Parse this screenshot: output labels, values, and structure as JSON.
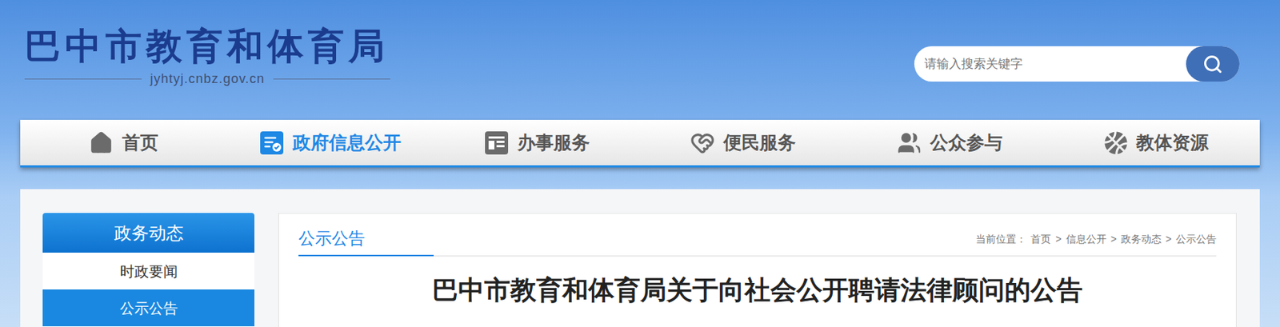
{
  "header": {
    "logo_title": "巴中市教育和体育局",
    "domain": "jyhtyj.cnbz.gov.cn"
  },
  "search": {
    "placeholder": "请输入搜索关键字"
  },
  "nav": [
    {
      "label": "首页",
      "selected": false,
      "kind": "home"
    },
    {
      "label": "政府信息公开",
      "selected": true,
      "kind": "info"
    },
    {
      "label": "办事服务",
      "selected": false,
      "kind": "service"
    },
    {
      "label": "便民服务",
      "selected": false,
      "kind": "convenience"
    },
    {
      "label": "公众参与",
      "selected": false,
      "kind": "public"
    },
    {
      "label": "教体资源",
      "selected": false,
      "kind": "resource"
    }
  ],
  "sidebar": {
    "title": "政务动态",
    "items": [
      {
        "label": "时政要闻",
        "selected": false
      },
      {
        "label": "公示公告",
        "selected": true
      }
    ]
  },
  "section": {
    "title": "公示公告"
  },
  "breadcrumb": {
    "label": "当前位置：",
    "separator": ">",
    "items": [
      "首页",
      "信息公开",
      "政务动态",
      "公示公告"
    ]
  },
  "article": {
    "title": "巴中市教育和体育局关于向社会公开聘请法律顾问的公告"
  }
}
